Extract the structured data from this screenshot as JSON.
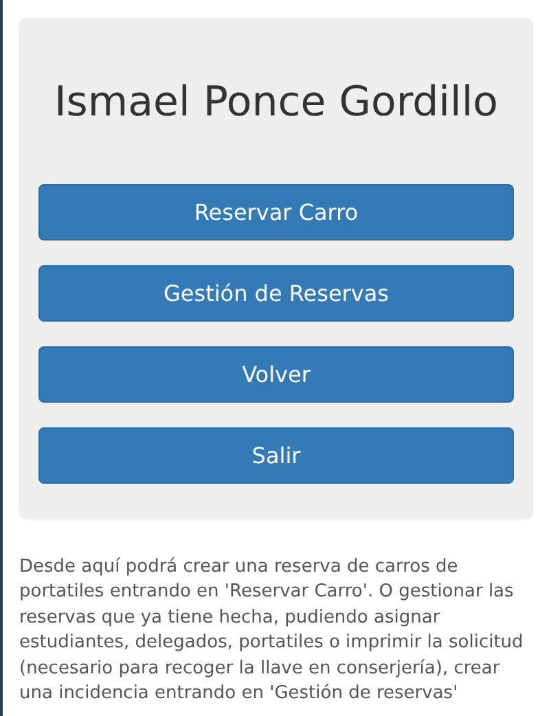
{
  "title": "Ismael Ponce Gordillo",
  "buttons": [
    "Reservar Carro",
    "Gestión de Reservas",
    "Volver",
    "Salir"
  ],
  "description": "Desde aquí podrá crear una reserva de carros de portatiles entrando en 'Reservar Carro'. O gestionar las reservas que ya tiene hecha, pudiendo asignar estudiantes, delegados, portatiles o imprimir la solicitud (necesario para recoger la llave en conserjería), crear una incidencia entrando en 'Gestión de reservas'"
}
